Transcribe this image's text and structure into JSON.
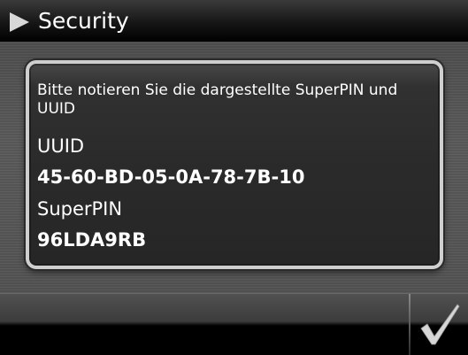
{
  "header": {
    "title": "Security",
    "icon": "play-arrow-icon"
  },
  "dialog": {
    "instruction": "Bitte notieren Sie die dargestellte SuperPIN und UUID",
    "uuid_label": "UUID",
    "uuid_value": "45-60-BD-05-0A-78-7B-10",
    "superpin_label": "SuperPIN",
    "superpin_value": "96LDA9RB"
  },
  "toolbar": {
    "confirm_icon": "checkmark-icon"
  },
  "colors": {
    "text": "#ffffff",
    "panel_border": "#cfcfcf",
    "panel_background": "#2b2b2b",
    "body_background": "#555555"
  }
}
